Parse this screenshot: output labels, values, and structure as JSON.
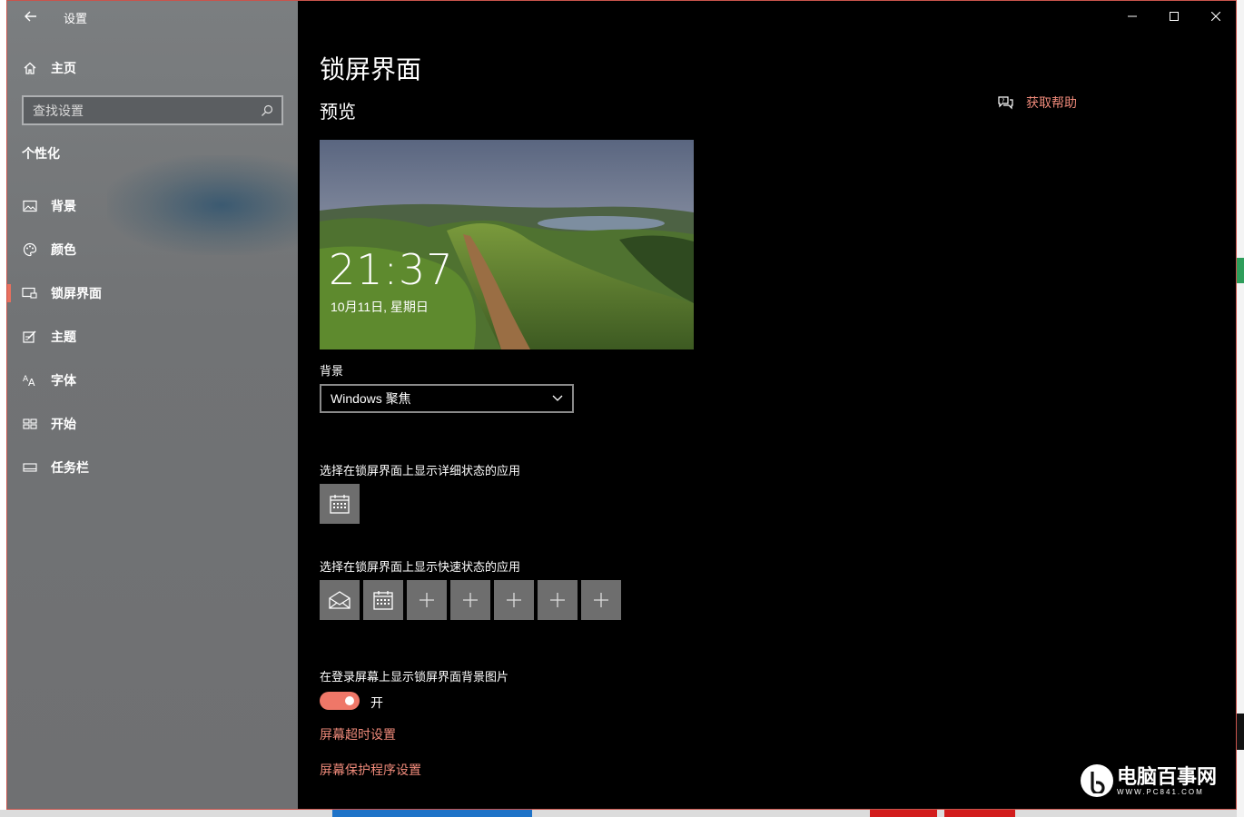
{
  "window": {
    "app_title": "设置",
    "controls": {
      "minimize": "minimize-icon",
      "maximize": "maximize-icon",
      "close": "close-icon"
    }
  },
  "sidebar": {
    "home_label": "主页",
    "search": {
      "placeholder": "查找设置",
      "value": ""
    },
    "section_label": "个性化",
    "items": [
      {
        "label": "背景",
        "icon": "picture-icon"
      },
      {
        "label": "颜色",
        "icon": "palette-icon"
      },
      {
        "label": "锁屏界面",
        "icon": "lock-screen-icon",
        "active": true
      },
      {
        "label": "主题",
        "icon": "theme-brush-icon"
      },
      {
        "label": "字体",
        "icon": "font-icon"
      },
      {
        "label": "开始",
        "icon": "start-grid-icon"
      },
      {
        "label": "任务栏",
        "icon": "taskbar-icon"
      }
    ]
  },
  "main": {
    "title": "锁屏界面",
    "preview_heading": "预览",
    "help_label": "获取帮助",
    "preview": {
      "time": "21:37",
      "date": "10月11日, 星期日"
    },
    "background_label": "背景",
    "background_value": "Windows 聚焦",
    "detailed_status_label": "选择在锁屏界面上显示详细状态的应用",
    "quick_status_label": "选择在锁屏界面上显示快速状态的应用",
    "quick_status_apps": [
      "mail-icon",
      "calendar-icon",
      "add-icon",
      "add-icon",
      "add-icon",
      "add-icon",
      "add-icon"
    ],
    "signin_bg_label": "在登录屏幕上显示锁屏界面背景图片",
    "toggle_state": "开",
    "screen_timeout_link": "屏幕超时设置",
    "screensaver_link": "屏幕保护程序设置"
  },
  "watermark": {
    "main": "电脑百事网",
    "sub": "WWW.PC841.COM"
  },
  "colors": {
    "accent": "#ef7768",
    "link": "#ef8a7a",
    "sidebar": "#737577",
    "content_bg": "#000000"
  }
}
